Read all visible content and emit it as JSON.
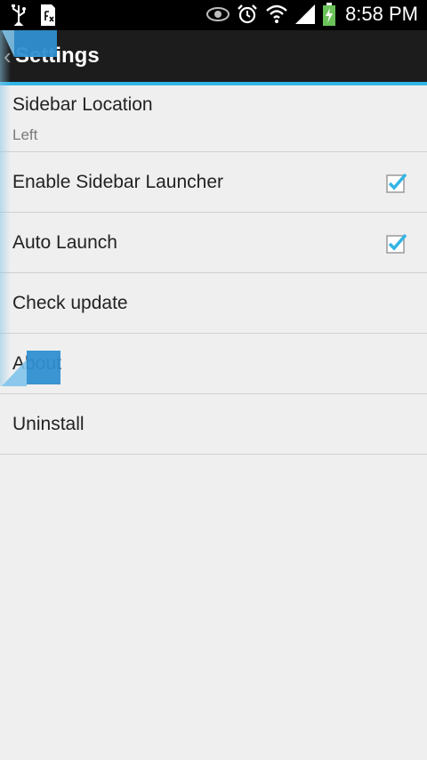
{
  "status_bar": {
    "time": "8:58 PM",
    "icons": [
      "usb-icon",
      "sd-card-icon",
      "eye-icon",
      "alarm-icon",
      "wifi-icon",
      "signal-icon",
      "battery-charging-icon"
    ]
  },
  "action_bar": {
    "title": "Settings",
    "accent_color": "#33b5e5"
  },
  "settings": {
    "sidebar_location": {
      "label": "Sidebar Location",
      "value": "Left"
    },
    "enable_sidebar_launcher": {
      "label": "Enable Sidebar Launcher",
      "checked": true
    },
    "auto_launch": {
      "label": "Auto Launch",
      "checked": true
    },
    "check_update": {
      "label": "Check update"
    },
    "about": {
      "label": "About"
    },
    "uninstall": {
      "label": "Uninstall"
    }
  },
  "colors": {
    "background": "#efefef",
    "action_bar": "#1c1c1c",
    "checkbox_check": "#33b5e5",
    "sidebar_handle": "#2f8fd0"
  }
}
